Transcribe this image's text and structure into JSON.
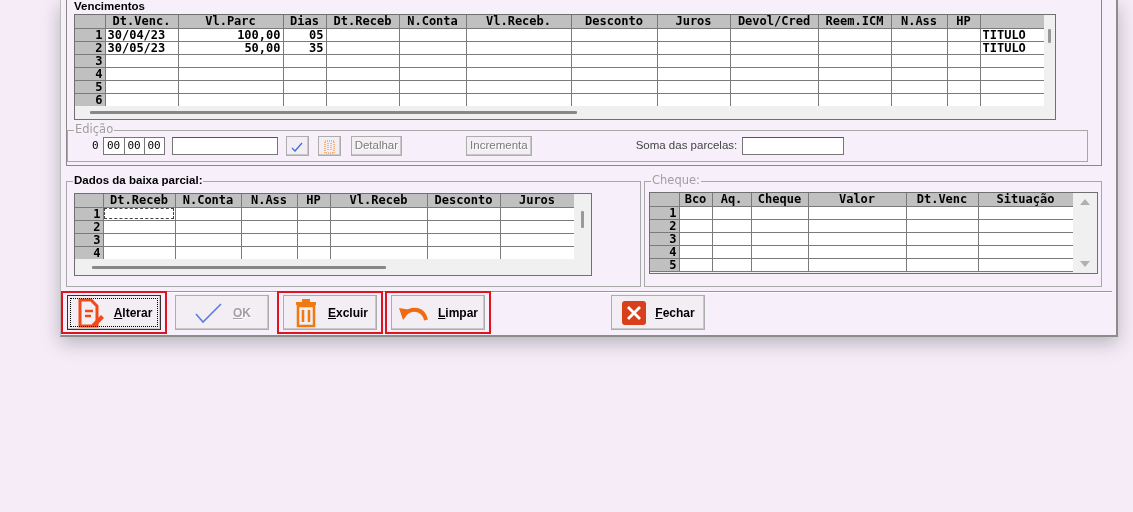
{
  "vencimentos": {
    "title": "Vencimentos",
    "columns": [
      "Dt.Venc.",
      "Vl.Parc",
      "Dias",
      "Dt.Receb",
      "N.Conta",
      "Vl.Receb.",
      "Desconto",
      "Juros",
      "Devol/Cred",
      "Reem.ICM",
      "N.Ass",
      "HP"
    ],
    "rows": [
      {
        "number": "1",
        "dt_venc": "30/04/23",
        "vl_parc": "100,00",
        "dias": "05",
        "column_13": "TITULO"
      },
      {
        "number": "2",
        "dt_venc": "30/05/23",
        "vl_parc": "50,00",
        "dias": "35",
        "column_13": "TITULO"
      },
      {
        "number": "3"
      },
      {
        "number": "4"
      },
      {
        "number": "5"
      },
      {
        "number": "6"
      }
    ]
  },
  "edicao": {
    "title": "Edição",
    "disabled": true,
    "index": "0",
    "time": [
      "00",
      "00",
      "00"
    ],
    "buttons": [
      {
        "kind": "check",
        "disabled": false
      },
      {
        "kind": "trash",
        "disabled": false
      },
      {
        "kind": "text",
        "label": "Detalhar",
        "disabled": true
      },
      {
        "kind": "text",
        "label": "Incrementa",
        "disabled": true
      }
    ],
    "sum_label": "Soma das parcelas:"
  },
  "baixa_parcial": {
    "title": "Dados da baixa parcial:",
    "disabled": false,
    "columns": [
      "Dt.Receb",
      "N.Conta",
      "N.Ass",
      "HP",
      "Vl.Receb",
      "Desconto",
      "Juros"
    ],
    "rows": [
      {
        "number": "1",
        "focused": true
      },
      {
        "number": "2",
        "focused": false
      },
      {
        "number": "3",
        "focused": false
      },
      {
        "number": "4",
        "focused": false
      }
    ]
  },
  "cheque": {
    "title": "Cheque:",
    "disabled": true,
    "columns": [
      "Bco",
      "Aq.",
      "Cheque",
      "Valor",
      "Dt.Venc",
      "Situação"
    ],
    "rows": [
      {
        "number": "1"
      },
      {
        "number": "2"
      },
      {
        "number": "3"
      },
      {
        "number": "4"
      },
      {
        "number": "5"
      }
    ]
  },
  "buttons": [
    {
      "label": "Alterar",
      "kind": "edit",
      "disabled": false,
      "focused": true,
      "highlighted": true
    },
    {
      "label": "OK",
      "kind": "check",
      "disabled": true,
      "focused": false,
      "highlighted": false
    },
    {
      "label": "Excluir",
      "kind": "trash",
      "disabled": false,
      "focused": false,
      "highlighted": true
    },
    {
      "label": "Limpar",
      "kind": "undo",
      "disabled": false,
      "focused": false,
      "highlighted": true
    },
    {
      "label": "Fechar",
      "kind": "close",
      "disabled": false,
      "focused": false,
      "highlighted": false
    }
  ]
}
